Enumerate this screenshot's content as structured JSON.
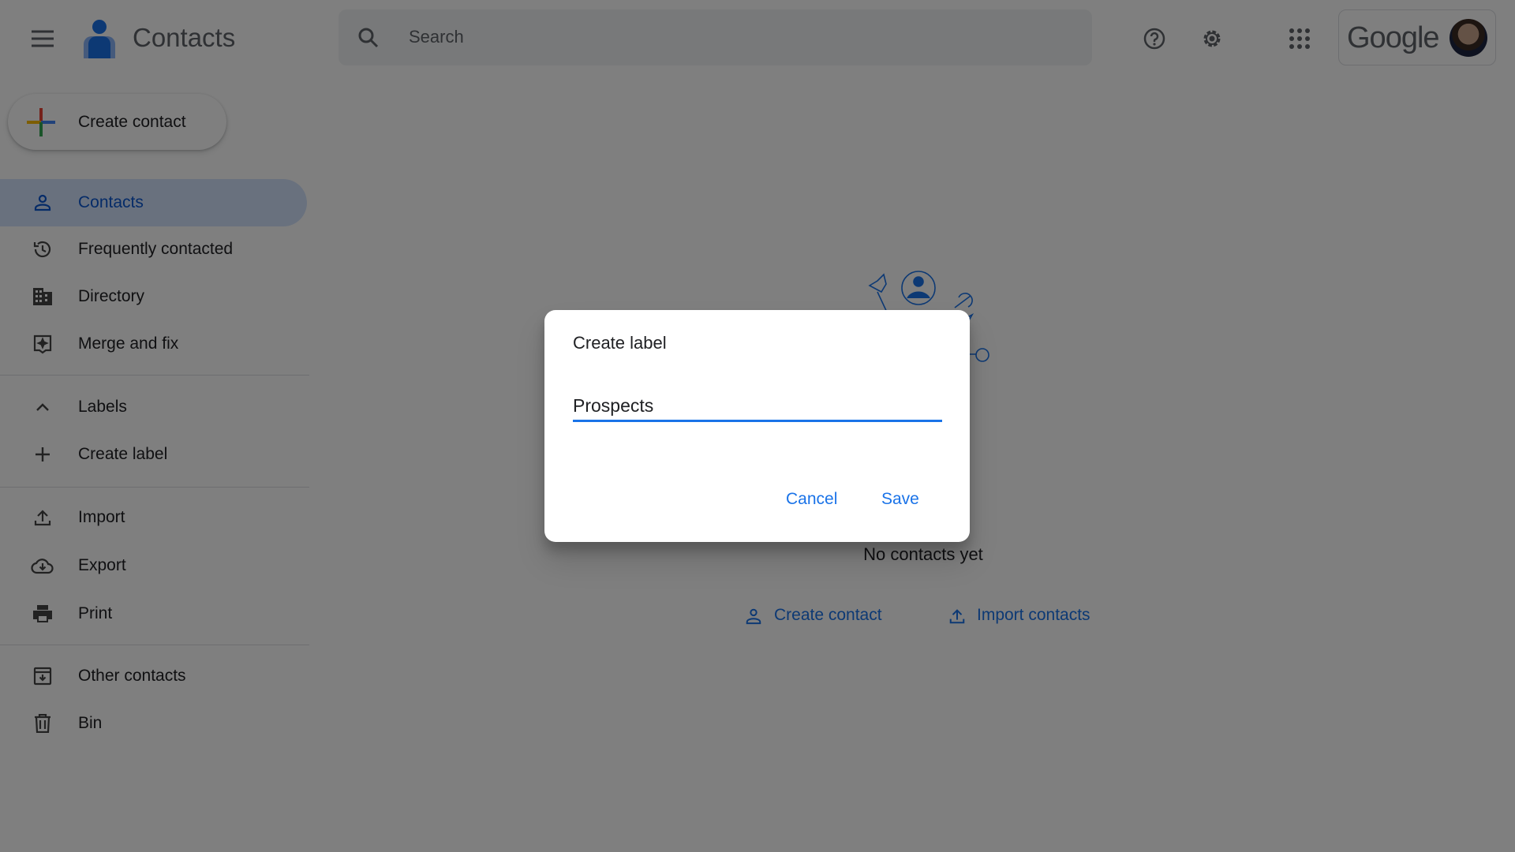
{
  "header": {
    "app_title": "Contacts",
    "search_placeholder": "Search",
    "google_logo": "Google",
    "icons": [
      "menu-icon",
      "contacts-logo-icon",
      "search-icon",
      "help-icon",
      "settings-icon",
      "apps-icon",
      "avatar"
    ]
  },
  "sidebar": {
    "create_button": "Create contact",
    "items": [
      {
        "label": "Contacts",
        "icon": "person-icon",
        "active": true
      },
      {
        "label": "Frequently contacted",
        "icon": "history-icon"
      },
      {
        "label": "Directory",
        "icon": "building-icon"
      },
      {
        "label": "Merge and fix",
        "icon": "merge-icon"
      }
    ],
    "labels_header": "Labels",
    "create_label": "Create label",
    "tools": [
      {
        "label": "Import",
        "icon": "upload-icon"
      },
      {
        "label": "Export",
        "icon": "cloud-download-icon"
      },
      {
        "label": "Print",
        "icon": "print-icon"
      }
    ],
    "other": [
      {
        "label": "Other contacts",
        "icon": "archive-icon"
      },
      {
        "label": "Bin",
        "icon": "trash-icon"
      }
    ]
  },
  "main": {
    "empty_text": "No contacts yet",
    "create_contact_link": "Create contact",
    "import_contacts_link": "Import contacts"
  },
  "dialog": {
    "title": "Create label",
    "input_value": "Prospects",
    "cancel": "Cancel",
    "save": "Save"
  },
  "colors": {
    "accent": "#1a73e8",
    "active_nav": "#d3e3fd",
    "scrim": "rgba(0,0,0,0.5)"
  }
}
